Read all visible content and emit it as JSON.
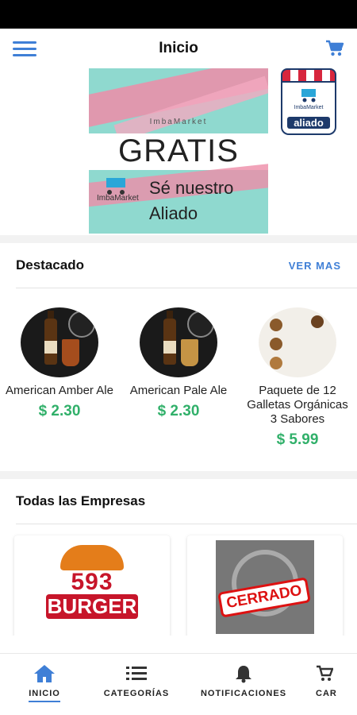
{
  "header": {
    "title": "Inicio"
  },
  "banner": {
    "brand_small": "ImbaMarket",
    "headline": "GRATIS",
    "line1": "Sé nuestro",
    "line2": "Aliado",
    "mini_logo": "ImbaMarket"
  },
  "badge": {
    "brand": "ImbaMarket",
    "label": "aliado"
  },
  "destacado": {
    "title": "Destacado",
    "more": "VER MAS",
    "products": [
      {
        "name": "American Amber Ale",
        "price": "$ 2.30"
      },
      {
        "name": "American Pale Ale",
        "price": "$ 2.30"
      },
      {
        "name": "Paquete de 12 Galletas Orgánicas 3 Sabores",
        "price": "$ 5.99"
      }
    ]
  },
  "empresas": {
    "title": "Todas las Empresas",
    "cards": [
      {
        "logo_top": "593",
        "logo_bottom": "BURGER"
      },
      {
        "stamp": "CERRADO"
      }
    ]
  },
  "nav": {
    "items": [
      {
        "label": "INICIO",
        "icon": "home-icon"
      },
      {
        "label": "CATEGORÍAS",
        "icon": "list-icon"
      },
      {
        "label": "NOTIFICACIONES",
        "icon": "bell-icon"
      },
      {
        "label": "CAR",
        "icon": "cart-icon"
      }
    ]
  },
  "colors": {
    "accent": "#3f7fd6",
    "price": "#31b06a",
    "closed": "#dd1111"
  }
}
